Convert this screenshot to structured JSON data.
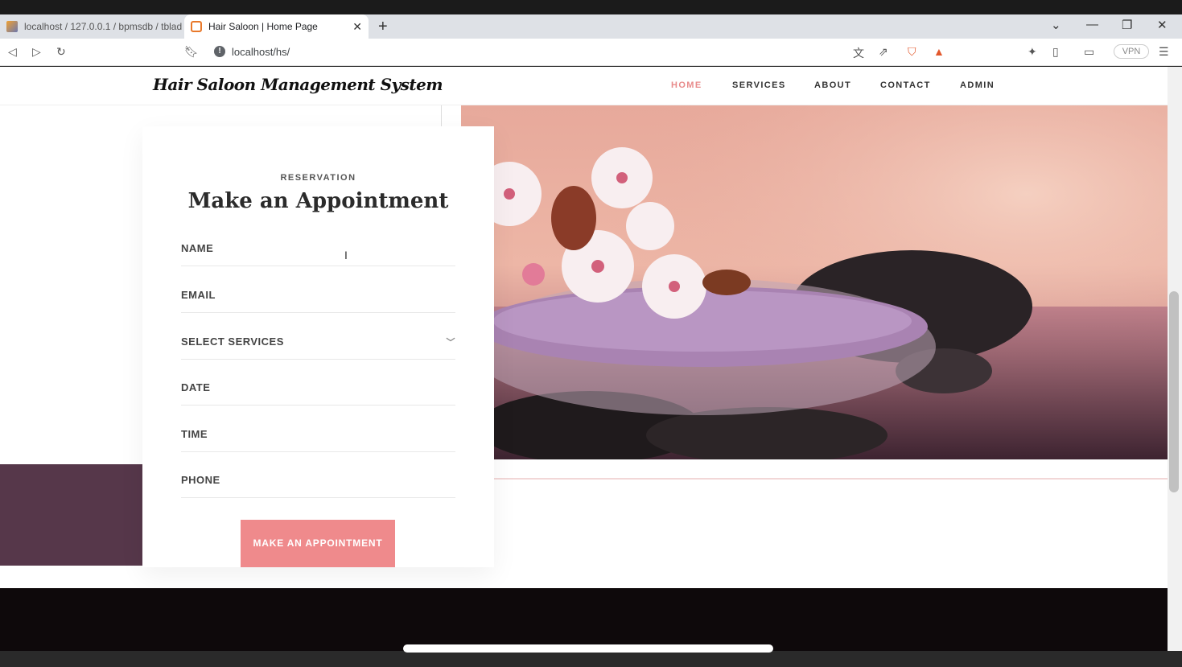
{
  "browser": {
    "tabs": [
      {
        "title": "localhost / 127.0.0.1 / bpmsdb / tblad",
        "active": false
      },
      {
        "title": "Hair Saloon | Home Page",
        "active": true
      }
    ],
    "new_tab_label": "+",
    "url": "localhost/hs/",
    "vpn_label": "VPN",
    "icons": [
      "back-icon",
      "forward-icon",
      "reload-icon",
      "bookmark-icon",
      "info-icon",
      "translate-icon",
      "share-icon",
      "brave-shield-icon",
      "brave-rewards-icon",
      "extensions-icon",
      "sidebar-icon",
      "wallet-icon",
      "menu-icon"
    ]
  },
  "site": {
    "logo": "Hair Saloon Management System",
    "nav": [
      {
        "label": "HOME",
        "active": true
      },
      {
        "label": "SERVICES",
        "active": false
      },
      {
        "label": "ABOUT",
        "active": false
      },
      {
        "label": "CONTACT",
        "active": false
      },
      {
        "label": "ADMIN",
        "active": false
      }
    ]
  },
  "form": {
    "eyebrow": "RESERVATION",
    "title": "Make an Appointment",
    "fields": {
      "name": "NAME",
      "email": "EMAIL",
      "services": "SELECT SERVICES",
      "date": "DATE",
      "time": "TIME",
      "phone": "PHONE"
    },
    "submit_label": "MAKE AN APPOINTMENT"
  },
  "colors": {
    "accent": "#ef8a8c",
    "nav_active": "#e88b8b",
    "plum_block": "#56374a",
    "footer": "#0e090b"
  }
}
